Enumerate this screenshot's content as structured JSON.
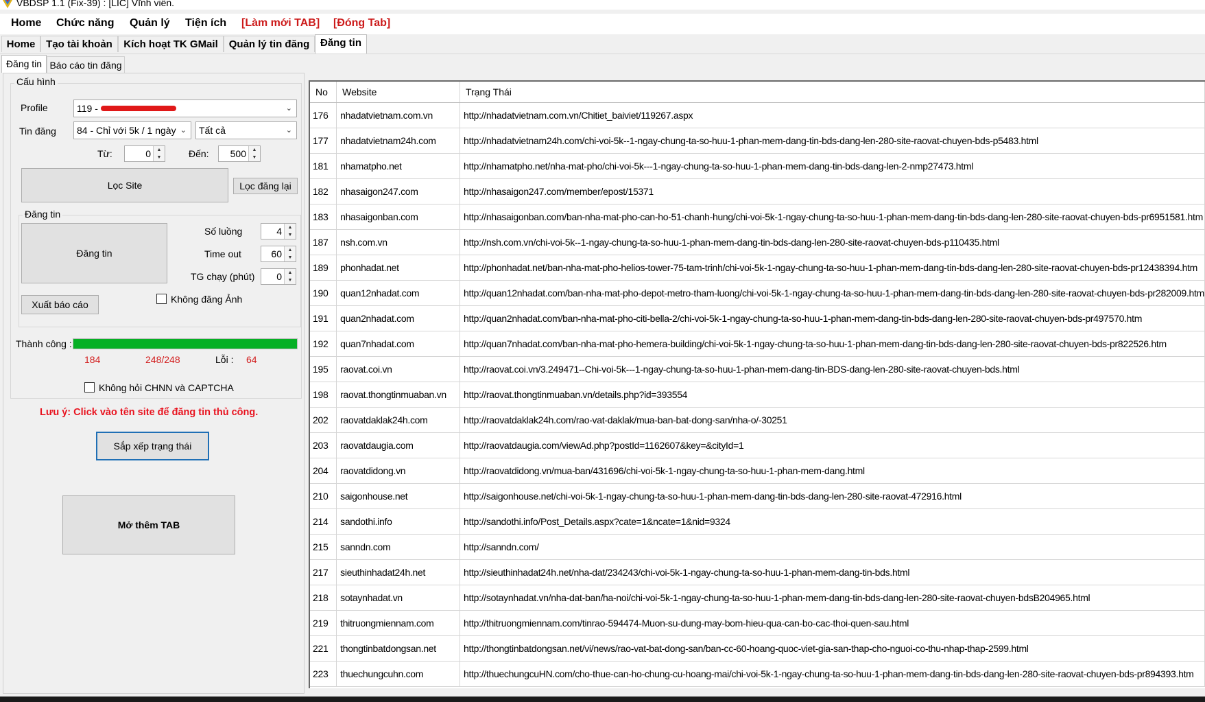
{
  "window": {
    "title": "VBDSP 1.1 (Fix-39) : [LIC] Vĩnh viễn."
  },
  "menubar": {
    "items": [
      "Home",
      "Chức năng",
      "Quản lý",
      "Tiện ích"
    ],
    "refresh_tab": "[Làm mới TAB]",
    "close_tab": "[Đóng Tab]"
  },
  "main_tabs": [
    "Home",
    "Tạo tài khoản",
    "Kích hoạt TK GMail",
    "Quản lý tin đăng",
    "Đăng tin"
  ],
  "sub_tabs": [
    "Đăng tin",
    "Báo cáo tin đăng"
  ],
  "config": {
    "group_title": "Cấu hình",
    "profile_label": "Profile",
    "profile_value": "119 - ",
    "post_label": "Tin đăng",
    "post_value": "84 - Chỉ với 5k / 1 ngày",
    "filter_value": "Tất cả",
    "from_label": "Từ:",
    "from_value": "0",
    "to_label": "Đến:",
    "to_value": "500",
    "filter_site_button": "Lọc Site",
    "refilter_button": "Lọc đăng lại"
  },
  "posting": {
    "group_title": "Đăng tin",
    "post_button": "Đăng tin",
    "quantity_label": "Số luồng",
    "quantity_value": "4",
    "timeout_label": "Time out",
    "timeout_value": "60",
    "runtime_label": "TG chạy (phút)",
    "runtime_value": "0",
    "export_button": "Xuất báo cáo",
    "no_image_label": "Không đăng Ảnh"
  },
  "status": {
    "success_label": "Thành công :",
    "progress_fraction": 1.0,
    "success_count": "184",
    "progress_text": "248/248",
    "error_label": "Lỗi :",
    "error_count": "64",
    "no_captcha_label": "Không hỏi CHNN và CAPTCHA",
    "note": "Lưu ý: Click vào tên site để đăng tin thủ công.",
    "sort_button": "Sắp xếp trạng thái",
    "open_tab_button": "Mở thêm TAB"
  },
  "colors": {
    "progress_fill": "#06b025",
    "note_red": "#e8131f",
    "menu_red": "#cc1a1a",
    "focus_blue": "#1f6fb5"
  },
  "grid": {
    "columns": [
      "No",
      "Website",
      "Trạng Thái"
    ],
    "rows": [
      [
        "176",
        "nhadatvietnam.com.vn",
        "http://nhadatvietnam.com.vn/Chitiet_baiviet/119267.aspx"
      ],
      [
        "177",
        "nhadatvietnam24h.com",
        "http://nhadatvietnam24h.com/chi-voi-5k--1-ngay-chung-ta-so-huu-1-phan-mem-dang-tin-bds-dang-len-280-site-raovat-chuyen-bds-p5483.html"
      ],
      [
        "181",
        "nhamatpho.net",
        "http://nhamatpho.net/nha-mat-pho/chi-voi-5k---1-ngay-chung-ta-so-huu-1-phan-mem-dang-tin-bds-dang-len-2-nmp27473.html"
      ],
      [
        "182",
        "nhasaigon247.com",
        "http://nhasaigon247.com/member/epost/15371"
      ],
      [
        "183",
        "nhasaigonban.com",
        "http://nhasaigonban.com/ban-nha-mat-pho-can-ho-51-chanh-hung/chi-voi-5k-1-ngay-chung-ta-so-huu-1-phan-mem-dang-tin-bds-dang-len-280-site-raovat-chuyen-bds-pr6951581.htm"
      ],
      [
        "187",
        "nsh.com.vn",
        "http://nsh.com.vn/chi-voi-5k--1-ngay-chung-ta-so-huu-1-phan-mem-dang-tin-bds-dang-len-280-site-raovat-chuyen-bds-p110435.html"
      ],
      [
        "189",
        "phonhadat.net",
        "http://phonhadat.net/ban-nha-mat-pho-helios-tower-75-tam-trinh/chi-voi-5k-1-ngay-chung-ta-so-huu-1-phan-mem-dang-tin-bds-dang-len-280-site-raovat-chuyen-bds-pr12438394.htm"
      ],
      [
        "190",
        "quan12nhadat.com",
        "http://quan12nhadat.com/ban-nha-mat-pho-depot-metro-tham-luong/chi-voi-5k-1-ngay-chung-ta-so-huu-1-phan-mem-dang-tin-bds-dang-len-280-site-raovat-chuyen-bds-pr282009.htm"
      ],
      [
        "191",
        "quan2nhadat.com",
        "http://quan2nhadat.com/ban-nha-mat-pho-citi-bella-2/chi-voi-5k-1-ngay-chung-ta-so-huu-1-phan-mem-dang-tin-bds-dang-len-280-site-raovat-chuyen-bds-pr497570.htm"
      ],
      [
        "192",
        "quan7nhadat.com",
        "http://quan7nhadat.com/ban-nha-mat-pho-hemera-building/chi-voi-5k-1-ngay-chung-ta-so-huu-1-phan-mem-dang-tin-bds-dang-len-280-site-raovat-chuyen-bds-pr822526.htm"
      ],
      [
        "195",
        "raovat.coi.vn",
        "http://raovat.coi.vn/3.249471--Chi-voi-5k---1-ngay-chung-ta-so-huu-1-phan-mem-dang-tin-BDS-dang-len-280-site-raovat-chuyen-bds.html"
      ],
      [
        "198",
        "raovat.thongtinmuaban.vn",
        "http://raovat.thongtinmuaban.vn/details.php?id=393554"
      ],
      [
        "202",
        "raovatdaklak24h.com",
        "http://raovatdaklak24h.com/rao-vat-daklak/mua-ban-bat-dong-san/nha-o/-30251"
      ],
      [
        "203",
        "raovatdaugia.com",
        "http://raovatdaugia.com/viewAd.php?postId=1162607&key=&cityId=1"
      ],
      [
        "204",
        "raovatdidong.vn",
        "http://raovatdidong.vn/mua-ban/431696/chi-voi-5k-1-ngay-chung-ta-so-huu-1-phan-mem-dang.html"
      ],
      [
        "210",
        "saigonhouse.net",
        "http://saigonhouse.net/chi-voi-5k-1-ngay-chung-ta-so-huu-1-phan-mem-dang-tin-bds-dang-len-280-site-raovat-472916.html"
      ],
      [
        "214",
        "sandothi.info",
        "http://sandothi.info/Post_Details.aspx?cate=1&ncate=1&nid=9324"
      ],
      [
        "215",
        "sanndn.com",
        "http://sanndn.com/"
      ],
      [
        "217",
        "sieuthinhadat24h.net",
        "http://sieuthinhadat24h.net/nha-dat/234243/chi-voi-5k-1-ngay-chung-ta-so-huu-1-phan-mem-dang-tin-bds.html"
      ],
      [
        "218",
        "sotaynhadat.vn",
        "http://sotaynhadat.vn/nha-dat-ban/ha-noi/chi-voi-5k-1-ngay-chung-ta-so-huu-1-phan-mem-dang-tin-bds-dang-len-280-site-raovat-chuyen-bdsB204965.html"
      ],
      [
        "219",
        "thitruongmiennam.com",
        "http://thitruongmiennam.com/tinrao-594474-Muon-su-dung-may-bom-hieu-qua-can-bo-cac-thoi-quen-sau.html"
      ],
      [
        "221",
        "thongtinbatdongsan.net",
        "http://thongtinbatdongsan.net/vi/news/rao-vat-bat-dong-san/ban-cc-60-hoang-quoc-viet-gia-san-thap-cho-nguoi-co-thu-nhap-thap-2599.html"
      ],
      [
        "223",
        "thuechungcuhn.com",
        "http://thuechungcuHN.com/cho-thue-can-ho-chung-cu-hoang-mai/chi-voi-5k-1-ngay-chung-ta-so-huu-1-phan-mem-dang-tin-bds-dang-len-280-site-raovat-chuyen-bds-pr894393.htm"
      ]
    ]
  }
}
